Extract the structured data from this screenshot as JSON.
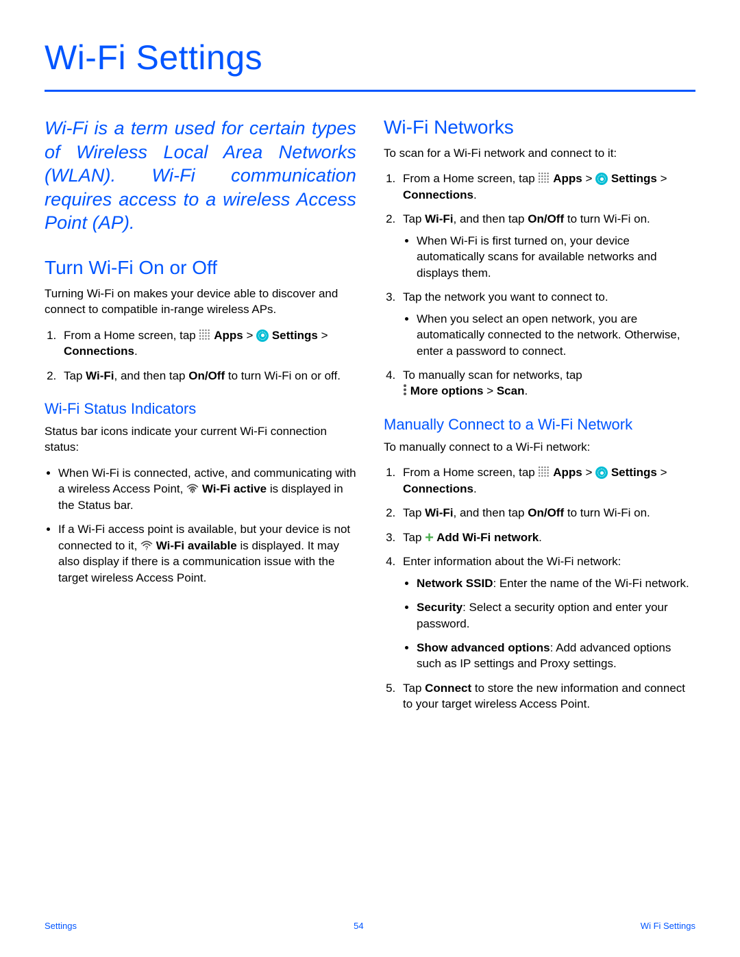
{
  "title": "Wi-Fi Settings",
  "intro": "Wi-Fi is a term used for certain types of Wireless Local Area Networks (WLAN). Wi-Fi communication requires access to a wireless Access Point (AP).",
  "left": {
    "h2_turn": "Turn Wi-Fi On or Off",
    "turn_desc": "Turning Wi-Fi on makes your device able to discover and connect to compatible in-range wireless APs.",
    "step1_a": "From a Home screen, tap ",
    "apps_label": " Apps",
    "caret": " > ",
    "settings_label": " Settings",
    "step1_b": " > ",
    "connections_label": "Connections",
    "step2_a": "Tap ",
    "wifi_label": "Wi-Fi",
    "step2_b": ", and then tap ",
    "onoff_label": "On/Off",
    "step2_c": " to turn Wi-Fi on or off.",
    "h3_status": "Wi-Fi Status Indicators",
    "status_desc": "Status bar icons indicate your current Wi-Fi connection status:",
    "bullet1_a": "When Wi-Fi is connected, active, and communicating with a wireless Access Point, ",
    "wifi_active_label": "Wi-Fi active",
    "bullet1_b": " is displayed in the Status bar.",
    "bullet2_a": "If a Wi-Fi access point is available, but your device is not connected to it, ",
    "wifi_avail_label": "Wi-Fi available",
    "bullet2_b": " is displayed. It may also display if there is a communication issue with the target wireless Access Point."
  },
  "right": {
    "h2_networks": "Wi-Fi Networks",
    "scan_desc": "To scan for a Wi-Fi network and connect to it:",
    "r_step1_a": "From a Home screen, tap ",
    "r_step1_b": " > ",
    "r_step2_c": " to turn Wi-Fi on.",
    "bullet_first_on": "When Wi-Fi is first turned on, your device automatically scans for available networks and displays them.",
    "r_step3": "Tap the network you want to connect to.",
    "bullet_open": "When you select an open network, you are automatically connected to the network. Otherwise, enter a password to connect.",
    "r_step4_a": "To manually scan for networks, tap",
    "more_label": " More options",
    "scan_label": "Scan",
    "h3_manual": "Manually Connect to a Wi-Fi Network",
    "manual_desc": "To manually connect to a Wi-Fi network:",
    "m_step3_a": "Tap ",
    "add_label": " Add Wi-Fi network",
    "m_step4": "Enter information about the Wi-Fi network:",
    "ssid_label": "Network SSID",
    "ssid_text": ": Enter the name of the Wi-Fi network.",
    "sec_label": "Security",
    "sec_text": ": Select a security option and enter your password.",
    "adv_label": "Show advanced options",
    "adv_text": ": Add advanced options such as IP settings and Proxy settings.",
    "m_step5_a": "Tap ",
    "connect_label": "Connect",
    "m_step5_b": " to store the new information and connect to your target wireless Access Point."
  },
  "footer": {
    "left": "Settings",
    "center": "54",
    "right": "Wi Fi Settings"
  },
  "period": "."
}
